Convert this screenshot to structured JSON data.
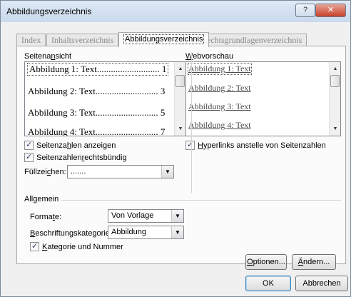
{
  "window": {
    "title": "Abbildungsverzeichnis",
    "help_label": "?",
    "close_label": "✕"
  },
  "tabs": [
    {
      "label": "Index",
      "active": false
    },
    {
      "label": "Inhaltsverzeichnis",
      "active": false
    },
    {
      "label": "Abbildungsverzeichnis",
      "active": true
    },
    {
      "label": "Rechtsgrundlagenverzeichnis",
      "active": false
    }
  ],
  "print_preview": {
    "label_pre": "Seitena",
    "label_key": "n",
    "label_post": "sicht",
    "entries": [
      {
        "text": "Abbildung 1: Text",
        "dots": "...........................",
        "page": "1"
      },
      {
        "text": "Abbildung 2: Text",
        "dots": "...........................",
        "page": "3"
      },
      {
        "text": "Abbildung 3: Text",
        "dots": "...........................",
        "page": "5"
      },
      {
        "text": "Abbildung 4: Text",
        "dots": "...........................",
        "page": "7"
      }
    ]
  },
  "web_preview": {
    "label_key": "W",
    "label_post": "ebvorschau",
    "entries": [
      "Abbildung 1: Text",
      "Abbildung 2: Text",
      "Abbildung 3: Text",
      "Abbildung 4: Text"
    ]
  },
  "options": {
    "show_page_numbers": {
      "pre": "Seitenza",
      "key": "h",
      "post": "len anzeigen",
      "checked": true
    },
    "right_align": {
      "pre": "Seitenzahlen ",
      "key": "r",
      "post": "echtsbündig",
      "checked": true
    },
    "tab_leader": {
      "pre": "Füllzei",
      "key": "c",
      "post": "hen:",
      "value": "......."
    },
    "hyperlinks": {
      "pre": "",
      "key": "H",
      "post": "yperlinks anstelle von Seitenzahlen",
      "checked": true
    }
  },
  "general": {
    "heading": "Allgemein",
    "formats": {
      "pre": "Forma",
      "key": "t",
      "post": "e:",
      "value": "Von Vorlage"
    },
    "caption": {
      "pre": "",
      "key": "B",
      "post": "eschriftungskategorie:",
      "value": "Abbildung"
    },
    "include": {
      "pre": "",
      "key": "K",
      "post": "ategorie und Nummer",
      "checked": true
    }
  },
  "buttons": {
    "options": {
      "key": "O",
      "post": "ptionen..."
    },
    "modify": {
      "key": "Ä",
      "post": "ndern..."
    },
    "ok": "OK",
    "cancel": "Abbrechen"
  }
}
